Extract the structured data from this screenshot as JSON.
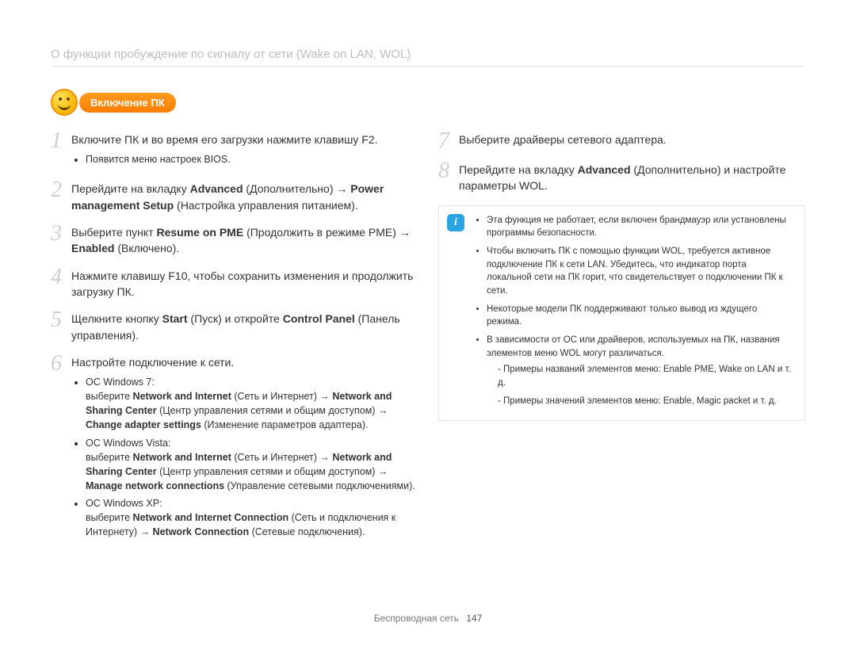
{
  "header": {
    "title": "О функции пробуждение по сигналу от сети (Wake on LAN, WOL)"
  },
  "badge": {
    "label": "Включение ПК"
  },
  "left_steps": {
    "s1": {
      "num": "1",
      "text_plain": "Включите ПК и во время его загрузки нажмите клавишу F2.",
      "sub1": "Появится меню настроек BIOS."
    },
    "s2": {
      "num": "2",
      "t1": "Перейдите на вкладку ",
      "b1": "Advanced",
      "t2": " (Дополнительно) → ",
      "b2": "Power management Setup",
      "t3": " (Настройка управления питанием)."
    },
    "s3": {
      "num": "3",
      "t1": "Выберите пункт ",
      "b1": "Resume on PME",
      "t2": " (Продолжить в режиме PME) → ",
      "b2": "Enabled",
      "t3": " (Включено)."
    },
    "s4": {
      "num": "4",
      "text_plain": "Нажмите клавишу F10, чтобы сохранить изменения и продолжить загрузку ПК."
    },
    "s5": {
      "num": "5",
      "t1": "Щелкните кнопку ",
      "b1": "Start",
      "t2": " (Пуск) и откройте ",
      "b2": "Control Panel",
      "t3": " (Панель управления)."
    },
    "s6": {
      "num": "6",
      "text_plain": "Настройте подключение к сети.",
      "os1_head": "ОС Windows 7:",
      "os1_t1": "выберите ",
      "os1_b1": "Network and Internet",
      "os1_t2": " (Сеть и Интернет) → ",
      "os1_b2": "Network and Sharing Center",
      "os1_t3": " (Центр управления сетями и общим доступом) → ",
      "os1_b3": "Change adapter settings",
      "os1_t4": " (Изменение параметров адаптера).",
      "os2_head": "ОС Windows Vista:",
      "os2_t1": "выберите ",
      "os2_b1": "Network and Internet",
      "os2_t2": " (Сеть и Интернет) → ",
      "os2_b2": "Network and Sharing Center",
      "os2_t3": " (Центр управления сетями и общим доступом) → ",
      "os2_b3": "Manage network connections",
      "os2_t4": " (Управление сетевыми подключениями).",
      "os3_head": "ОС Windows XP:",
      "os3_t1": "выберите ",
      "os3_b1": "Network and Internet Connection",
      "os3_t2": " (Сеть и подключения к Интернету) → ",
      "os3_b2": "Network Connection",
      "os3_t3": " (Сетевые подключения)."
    }
  },
  "right_steps": {
    "s7": {
      "num": "7",
      "text_plain": "Выберите драйверы сетевого адаптера."
    },
    "s8": {
      "num": "8",
      "t1": "Перейдите на вкладку ",
      "b1": "Advanced",
      "t2": " (Дополнительно) и настройте параметры WOL."
    }
  },
  "note": {
    "n1": "Эта функция не работает, если включен брандмауэр или установлены программы безопасности.",
    "n2": "Чтобы включить ПК с помощью функции WOL, требуется активное подключение ПК к сети LAN. Убедитесь, что индикатор порта локальной сети на ПК горит, что свидетельствует о подключении ПК к сети.",
    "n3": "Некоторые модели ПК поддерживают только вывод из ждущего режима.",
    "n4": "В зависимости от ОС или драйверов, используемых на ПК, названия элементов меню WOL могут различаться.",
    "n4a": "Примеры названий элементов меню: Enable PME, Wake on LAN и т. д.",
    "n4b": "Примеры значений элементов меню: Enable, Magic packet и т. д."
  },
  "footer": {
    "section": "Беспроводная сеть",
    "page": "147"
  }
}
